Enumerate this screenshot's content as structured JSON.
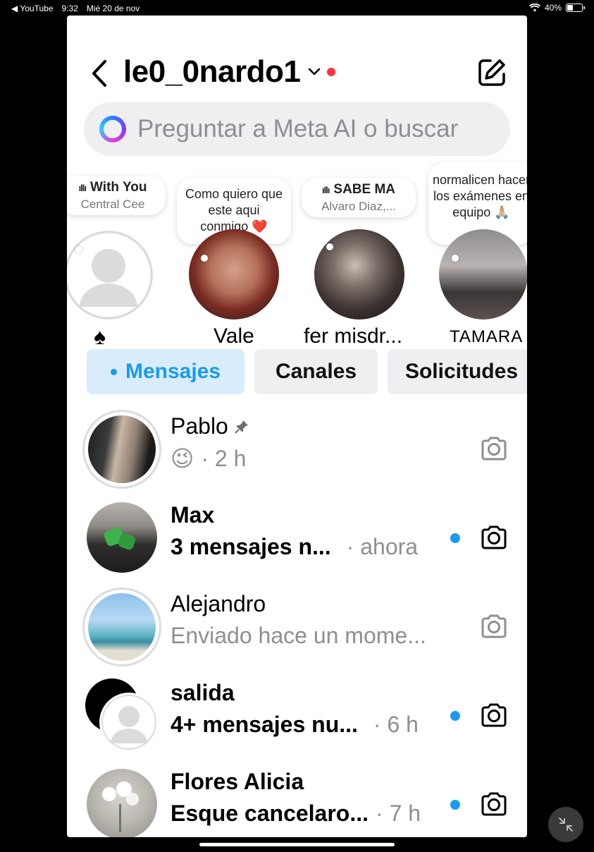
{
  "status_bar": {
    "back_app": "◀ YouTube",
    "time": "9:32",
    "date": "Mié 20 de nov",
    "battery": "40%",
    "battery_level": 0.4
  },
  "header": {
    "username": "le0_0nardo1",
    "icons": [
      "back-arrow-icon",
      "chevron-down-icon",
      "compose-icon"
    ]
  },
  "search": {
    "placeholder": "Preguntar a Meta AI o buscar"
  },
  "notes": [
    {
      "bubble_title": "With You",
      "bubble_sub": "Central Cee",
      "name": "♠",
      "type": "music"
    },
    {
      "bubble_text": "Como quiero que este aqui conmigo ❤️",
      "name": "Vale",
      "type": "text"
    },
    {
      "bubble_title": "SABE   MA",
      "bubble_sub": "Alvaro Diaz,...",
      "name": "fer misdr...",
      "type": "music"
    },
    {
      "bubble_text": "normalicen hacer los exámenes en equipo 🙏🏼",
      "name": "TAMARA",
      "type": "text"
    }
  ],
  "tabs": [
    {
      "label": "Mensajes",
      "active": true
    },
    {
      "label": "Canales",
      "active": false
    },
    {
      "label": "Solicitudes",
      "active": false
    }
  ],
  "threads": [
    {
      "name": "Pablo",
      "pinned": true,
      "preview": "😉",
      "time": "· 2 h",
      "unread": false,
      "bold": false
    },
    {
      "name": "Max",
      "pinned": false,
      "preview": "3 mensajes n...",
      "time": "· ahora",
      "unread": true,
      "bold": true
    },
    {
      "name": "Alejandro",
      "pinned": false,
      "preview": "Enviado hace un mome...",
      "time": "",
      "unread": false,
      "bold": false
    },
    {
      "name": "salida",
      "pinned": false,
      "preview": "4+ mensajes nu...",
      "time": "· 6 h",
      "unread": true,
      "bold": true
    },
    {
      "name": "Flores Alicia",
      "pinned": false,
      "preview": "Esque cancelaro...",
      "time": "· 7 h",
      "unread": true,
      "bold": true
    }
  ],
  "colors": {
    "accent": "#1a9bf0",
    "active_dot": "#ff3040",
    "chip_bg": "#efeff1",
    "chip_active_bg": "#d9ecfc"
  }
}
